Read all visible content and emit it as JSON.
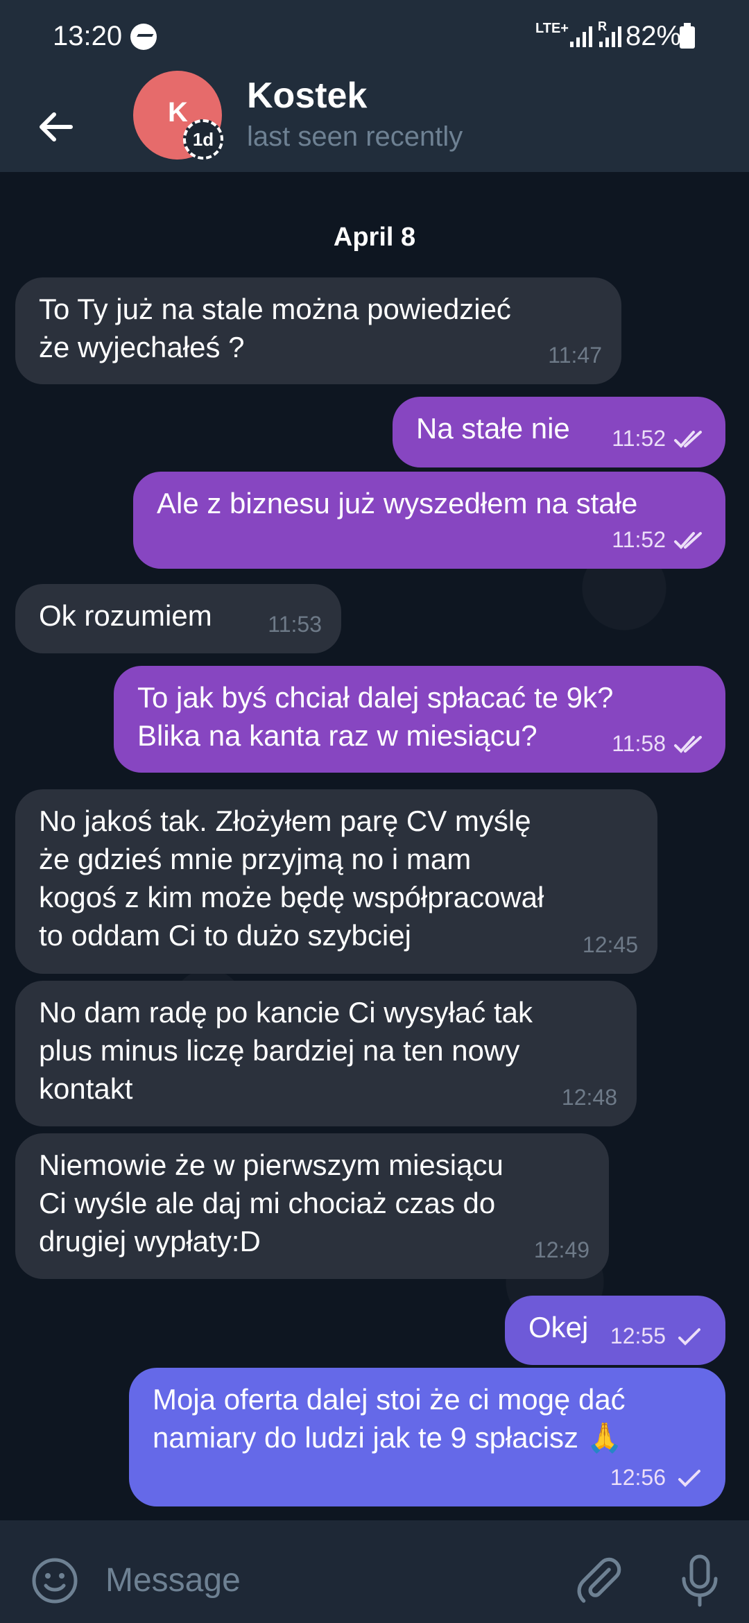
{
  "status_bar": {
    "time": "13:20",
    "network": "LTE+",
    "roaming": "R",
    "battery": "82%",
    "icons": [
      "messenger-icon",
      "signal-icon",
      "battery-icon"
    ]
  },
  "header": {
    "avatar_letter": "K",
    "avatar_color": "#e66b6b",
    "story_badge": "1d",
    "name": "Kostek",
    "status": "last seen recently",
    "icons": [
      "back-arrow-icon",
      "phone-icon",
      "more-vert-icon"
    ]
  },
  "chat": {
    "date": "April 8",
    "messages": [
      {
        "dir": "in",
        "text": "To Ty już na stale można powiedzieć\nże wyjechałeś ?",
        "time": "11:47"
      },
      {
        "dir": "out",
        "text": "Na stałe nie",
        "time": "11:52",
        "status": "read"
      },
      {
        "dir": "out",
        "text": "Ale z biznesu już wyszedłem na stałe",
        "time": "11:52",
        "status": "read"
      },
      {
        "dir": "in",
        "text": "Ok rozumiem",
        "time": "11:53"
      },
      {
        "dir": "out",
        "text": "To jak byś chciał dalej spłacać te 9k?\nBlika na kanta raz w miesiącu?",
        "time": "11:58",
        "status": "read"
      },
      {
        "dir": "in",
        "text": "No jakoś tak. Złożyłem parę CV myślę\nże gdzieś mnie przyjmą no i mam\nkogoś z kim może będę współpracował\nto oddam Ci to dużo szybciej",
        "time": "12:45"
      },
      {
        "dir": "in",
        "text": "No dam radę po kancie Ci wysyłać tak\nplus minus liczę bardziej na ten nowy\nkontakt",
        "time": "12:48"
      },
      {
        "dir": "in",
        "text": "Niemowie że w pierwszym miesiącu\nCi wyśle ale daj mi chociaż czas do\ndrugiej wypłaty:D",
        "time": "12:49"
      },
      {
        "dir": "out",
        "text": "Okej",
        "time": "12:55",
        "status": "sent"
      },
      {
        "dir": "out",
        "text": "Moja oferta dalej stoi że ci mogę dać\nnamiary do ludzi jak te 9 spłacisz 🙏",
        "time": "12:56",
        "status": "sent"
      }
    ]
  },
  "input": {
    "placeholder": "Message",
    "icons": [
      "emoji-icon",
      "attach-icon",
      "mic-icon"
    ]
  },
  "colors": {
    "chat_bg": "#0e1621",
    "header_bg": "#212d3b",
    "incoming_bubble": "#2b313c",
    "outgoing_bubble": "#8746c1",
    "outgoing_bubble_last": "#6569e8"
  }
}
